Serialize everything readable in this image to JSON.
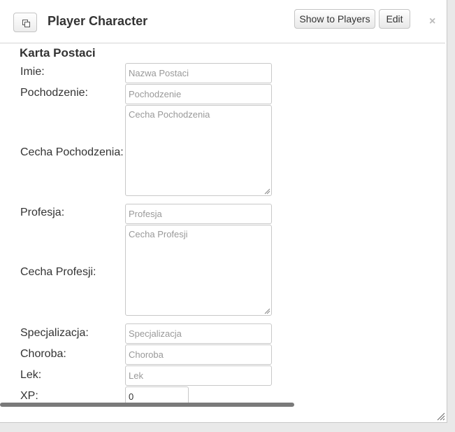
{
  "dialog": {
    "title": "Player Character",
    "show_to_players_label": "Show to Players",
    "edit_label": "Edit",
    "close_label": "×"
  },
  "sheet": {
    "title": "Karta Postaci",
    "fields": {
      "name": {
        "label": "Imie:",
        "placeholder": "Nazwa Postaci",
        "value": ""
      },
      "origin": {
        "label": "Pochodzenie:",
        "placeholder": "Pochodzenie",
        "value": ""
      },
      "origin_trait": {
        "label": "Cecha Pochodzenia:",
        "placeholder": "Cecha Pochodzenia",
        "value": ""
      },
      "profession": {
        "label": "Profesja:",
        "placeholder": "Profesja",
        "value": ""
      },
      "profession_trait": {
        "label": "Cecha Profesji:",
        "placeholder": "Cecha Profesji",
        "value": ""
      },
      "specialization": {
        "label": "Specjalizacja:",
        "placeholder": "Specjalizacja",
        "value": ""
      },
      "disease": {
        "label": "Choroba:",
        "placeholder": "Choroba",
        "value": ""
      },
      "fear": {
        "label": "Lek:",
        "placeholder": "Lek",
        "value": ""
      },
      "xp": {
        "label": "XP:",
        "value": "0"
      }
    }
  },
  "icons": {
    "popout": "popout-icon",
    "close": "close-icon",
    "resize": "resize-grip-icon"
  }
}
